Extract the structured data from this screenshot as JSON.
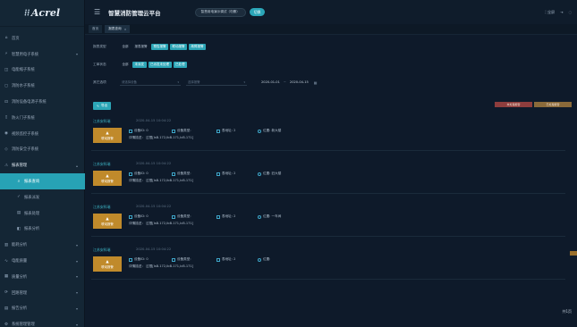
{
  "app": {
    "logo": "Acrel",
    "title": "智慧消防管理云平台",
    "project_name": "智慧用电演示调试（勿删）",
    "switch_label": "切换",
    "fullscreen_label": "全屏"
  },
  "sidebar": {
    "items": [
      {
        "label": "首页",
        "icon": "home-icon",
        "arrow": false
      },
      {
        "label": "智慧用电子系统",
        "icon": "power-icon",
        "arrow": true
      },
      {
        "label": "电能缩子系统",
        "icon": "meter-icon",
        "arrow": false
      },
      {
        "label": "消防水子系统",
        "icon": "water-icon",
        "arrow": false
      },
      {
        "label": "消防设备电源子系统",
        "icon": "plug-icon",
        "arrow": false
      },
      {
        "label": "防火门子系统",
        "icon": "door-icon",
        "arrow": false
      },
      {
        "label": "视频监控子系统",
        "icon": "camera-icon",
        "arrow": false
      },
      {
        "label": "消防安全子系统",
        "icon": "shield-icon",
        "arrow": false
      },
      {
        "label": "报表管理",
        "icon": "alert-icon",
        "arrow": true,
        "open": true
      },
      {
        "label": "报表查询",
        "icon": "search-icon",
        "sub": true,
        "active": true
      },
      {
        "label": "报表派发",
        "icon": "check-icon",
        "sub": true
      },
      {
        "label": "报表处理",
        "icon": "doc-icon",
        "sub": true
      },
      {
        "label": "报表分析",
        "icon": "chart-icon",
        "sub": true
      },
      {
        "label": "能耗分析",
        "icon": "bars-icon",
        "arrow": true
      },
      {
        "label": "电能质量",
        "icon": "pulse-icon",
        "arrow": true
      },
      {
        "label": "质量分析",
        "icon": "grid-icon",
        "arrow": true
      },
      {
        "label": "回路管理",
        "icon": "loop-icon",
        "arrow": true
      },
      {
        "label": "报告分析",
        "icon": "report-icon",
        "arrow": true
      },
      {
        "label": "系统管理管理",
        "icon": "settings-icon",
        "arrow": true
      }
    ]
  },
  "tabs": [
    {
      "label": "首页",
      "closable": false
    },
    {
      "label": "报表查询",
      "closable": true
    }
  ],
  "filters": {
    "alarm_type_label": "报表类型",
    "alarm_type_options": [
      {
        "label": "全部",
        "on": false
      },
      {
        "label": "报表报警",
        "on": false
      },
      {
        "label": "预告报警",
        "on": true
      },
      {
        "label": "联动报警",
        "on": true
      },
      {
        "label": "故障报警",
        "on": true
      }
    ],
    "order_status_label": "工单状态",
    "order_status_options": [
      {
        "label": "全部",
        "on": false
      },
      {
        "label": "未派发",
        "on": true
      },
      {
        "label": "已派发未处理",
        "on": true
      },
      {
        "label": "已处理",
        "on": true
      }
    ],
    "other_label": "其它选项",
    "device_placeholder": "请选择设备",
    "type_placeholder": "选择报警",
    "date_from": "2020-01-01",
    "date_sep": "~",
    "date_to": "2020-04-15"
  },
  "toolbar": {
    "export_label": "导出",
    "legend_left": "未处理报警",
    "legend_right": "已处理报警",
    "legend_left_color": "#8e3d3d",
    "legend_right_color": "#8a6a3a"
  },
  "alarms": [
    {
      "project": "江苏安科瑞",
      "time": "2020-04-15 10:04:22",
      "tag": "联动报警",
      "device_id": "设备ID: 0",
      "device_type": "设备类型:",
      "address": "表地址: 2",
      "location": "位置: 新大楼",
      "detail": "详情描述：  过限[IsB.172,IbB.171,IcB.171]"
    },
    {
      "project": "江苏安科瑞",
      "time": "2020-04-15 10:04:22",
      "tag": "联动报警",
      "device_id": "设备ID: 0",
      "device_type": "设备类型:",
      "address": "表地址: 2",
      "location": "位置: 旧大楼",
      "detail": "详情描述：  过限[IsB.172,IbB.171,IcB.171]"
    },
    {
      "project": "江苏安科瑞",
      "time": "2020-04-15 10:04:22",
      "tag": "联动报警",
      "device_id": "设备ID: 0",
      "device_type": "设备类型:",
      "address": "表地址: 2",
      "location": "位置: 一车间",
      "detail": "详情描述：  过限[IsB.172,IbB.171,IcB.171]"
    },
    {
      "project": "江苏安科瑞",
      "time": "2020-04-15 10:04:22",
      "tag": "联动报警",
      "device_id": "设备ID: 0",
      "device_type": "设备类型:",
      "address": "表地址: 2",
      "location": "位置:",
      "detail": "详情描述：  过限[IsB.172,IbB.171,IcB.171]"
    }
  ],
  "pager": {
    "total": "共1页"
  }
}
